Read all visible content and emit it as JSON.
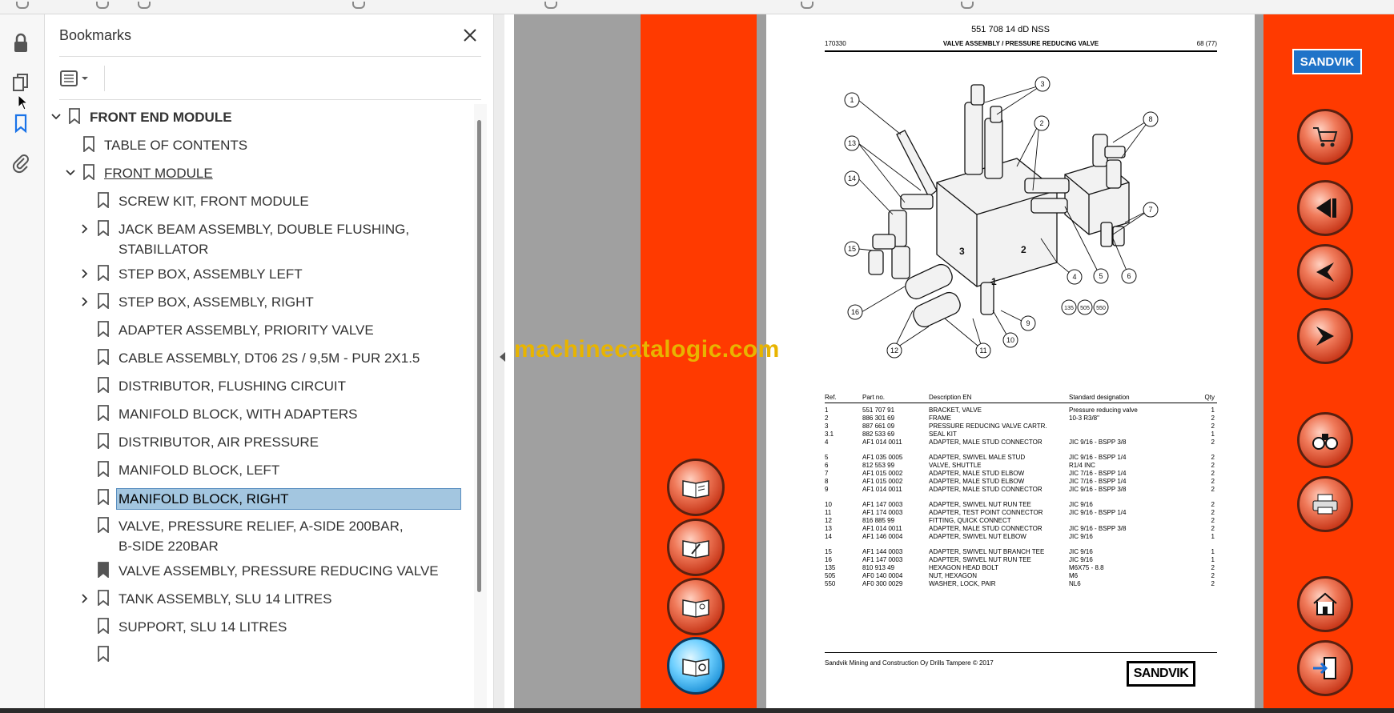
{
  "panel": {
    "title": "Bookmarks",
    "items": [
      {
        "label": "FRONT END MODULE"
      },
      {
        "label": "TABLE OF CONTENTS"
      },
      {
        "label": "FRONT MODULE"
      },
      {
        "label": "SCREW KIT, FRONT MODULE"
      },
      {
        "label": "JACK BEAM ASSEMBLY, DOUBLE FLUSHING, STABILLATOR"
      },
      {
        "label": "STEP BOX, ASSEMBLY LEFT"
      },
      {
        "label": "STEP BOX, ASSEMBLY, RIGHT"
      },
      {
        "label": "ADAPTER ASSEMBLY, PRIORITY VALVE"
      },
      {
        "label": "CABLE ASSEMBLY, DT06 2S / 9,5M - PUR 2X1.5"
      },
      {
        "label": "DISTRIBUTOR, FLUSHING CIRCUIT"
      },
      {
        "label": "MANIFOLD BLOCK, WITH ADAPTERS"
      },
      {
        "label": "DISTRIBUTOR, AIR PRESSURE"
      },
      {
        "label": "MANIFOLD BLOCK, LEFT"
      },
      {
        "label": "MANIFOLD BLOCK, RIGHT"
      },
      {
        "label": "VALVE, PRESSURE RELIEF, A-SIDE 200BAR, B-SIDE 220BAR"
      },
      {
        "label": "VALVE ASSEMBLY, PRESSURE REDUCING VALVE"
      },
      {
        "label": "TANK ASSEMBLY, SLU 14 LITRES"
      },
      {
        "label": "SUPPORT, SLU 14 LITRES"
      }
    ]
  },
  "document": {
    "doc_number": "551 708 14 dD NSS",
    "code": "170330",
    "section_title": "VALVE ASSEMBLY / PRESSURE REDUCING VALVE",
    "page": "68 (77)",
    "table_headers": {
      "ref": "Ref.",
      "part": "Part no.",
      "desc": "Description EN",
      "std": "Standard designation",
      "qty": "Qty"
    },
    "rows": [
      {
        "ref": "1",
        "part": "551 707 91",
        "desc": "BRACKET, VALVE",
        "std": "Pressure reducing valve",
        "qty": "1"
      },
      {
        "ref": "2",
        "part": "886 301 69",
        "desc": "FRAME",
        "std": "10-3 R3/8\"",
        "qty": "2"
      },
      {
        "ref": "3",
        "part": "887 661 09",
        "desc": "PRESSURE REDUCING VALVE CARTR.",
        "std": "",
        "qty": "2"
      },
      {
        "ref": "3.1",
        "part": "882 533 69",
        "desc": "SEAL KIT",
        "std": "",
        "qty": "1"
      },
      {
        "ref": "4",
        "part": "AF1 014 0011",
        "desc": "ADAPTER, MALE STUD CONNECTOR",
        "std": "JIC 9/16 - BSPP 3/8",
        "qty": "2"
      },
      {
        "ref": "5",
        "part": "AF1 035 0005",
        "desc": "ADAPTER, SWIVEL MALE STUD",
        "std": "JIC 9/16 - BSPP 1/4",
        "qty": "2"
      },
      {
        "ref": "6",
        "part": "812 553 99",
        "desc": "VALVE, SHUTTLE",
        "std": "R1/4 INC",
        "qty": "2"
      },
      {
        "ref": "7",
        "part": "AF1 015 0002",
        "desc": "ADAPTER, MALE STUD ELBOW",
        "std": "JIC 7/16 - BSPP 1/4",
        "qty": "2"
      },
      {
        "ref": "8",
        "part": "AF1 015 0002",
        "desc": "ADAPTER, MALE STUD ELBOW",
        "std": "JIC 7/16 - BSPP 1/4",
        "qty": "2"
      },
      {
        "ref": "9",
        "part": "AF1 014 0011",
        "desc": "ADAPTER, MALE STUD CONNECTOR",
        "std": "JIC 9/16 - BSPP 3/8",
        "qty": "2"
      },
      {
        "ref": "10",
        "part": "AF1 147 0003",
        "desc": "ADAPTER, SWIVEL NUT RUN TEE",
        "std": "JIC 9/16",
        "qty": "2"
      },
      {
        "ref": "11",
        "part": "AF1 174 0003",
        "desc": "ADAPTER, TEST POINT CONNECTOR",
        "std": "JIC 9/16 - BSPP 1/4",
        "qty": "2"
      },
      {
        "ref": "12",
        "part": "816 885 99",
        "desc": "FITTING, QUICK CONNECT",
        "std": "",
        "qty": "2"
      },
      {
        "ref": "13",
        "part": "AF1 014 0011",
        "desc": "ADAPTER, MALE STUD CONNECTOR",
        "std": "JIC 9/16 - BSPP 3/8",
        "qty": "2"
      },
      {
        "ref": "14",
        "part": "AF1 146 0004",
        "desc": "ADAPTER, SWIVEL NUT ELBOW",
        "std": "JIC 9/16",
        "qty": "1"
      },
      {
        "ref": "15",
        "part": "AF1 144 0003",
        "desc": "ADAPTER, SWIVEL NUT BRANCH TEE",
        "std": "JIC 9/16",
        "qty": "1"
      },
      {
        "ref": "16",
        "part": "AF1 147 0003",
        "desc": "ADAPTER, SWIVEL NUT RUN TEE",
        "std": "JIC 9/16",
        "qty": "1"
      },
      {
        "ref": "135",
        "part": "810 913 49",
        "desc": "HEXAGON HEAD BOLT",
        "std": "M6X75 - 8.8",
        "qty": "2"
      },
      {
        "ref": "505",
        "part": "AF0 140 0004",
        "desc": "NUT, HEXAGON",
        "std": "M6",
        "qty": "2"
      },
      {
        "ref": "550",
        "part": "AF0 300 0029",
        "desc": "WASHER, LOCK, PAIR",
        "std": "NL6",
        "qty": "2"
      }
    ],
    "callouts": [
      "1",
      "2",
      "3",
      "4",
      "5",
      "6",
      "7",
      "8",
      "9",
      "10",
      "11",
      "12",
      "13",
      "14",
      "15",
      "16",
      "135",
      "505",
      "550"
    ],
    "diagram_marks": [
      "1",
      "2",
      "3"
    ],
    "footer": "Sandvik Mining and Construction Oy Drills Tampere © 2017",
    "brand": "SANDVIK"
  },
  "watermark": "machinecatalogic.com",
  "colors": {
    "accent_red": "#ff3a00",
    "selection": "#a3c6e0",
    "sandvik_blue": "#1f73c8"
  },
  "nav_buttons": [
    "cart-icon",
    "first-page-icon",
    "previous-page-icon",
    "next-page-icon",
    "binoculars-icon",
    "printer-icon",
    "home-icon",
    "exit-icon"
  ],
  "left_buttons": [
    "book-hand-icon",
    "book-edit-icon",
    "book-tool-icon",
    "book-info-icon"
  ]
}
